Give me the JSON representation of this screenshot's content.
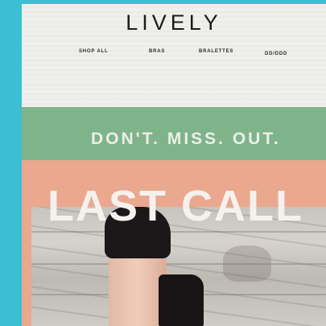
{
  "brand": {
    "logo": "LIVELY"
  },
  "nav": {
    "items": [
      {
        "label": "SHOP ALL"
      },
      {
        "label": "BRAS"
      },
      {
        "label": "BRALETTES"
      },
      {
        "label": "DD/DDD"
      }
    ]
  },
  "hero": {
    "tagline": "DON'T. MISS. OUT.",
    "headline": "LAST CALL"
  },
  "colors": {
    "frame": "#3cbfd3",
    "green_band": "#7fb48b",
    "peach_band": "#eaa88e"
  }
}
